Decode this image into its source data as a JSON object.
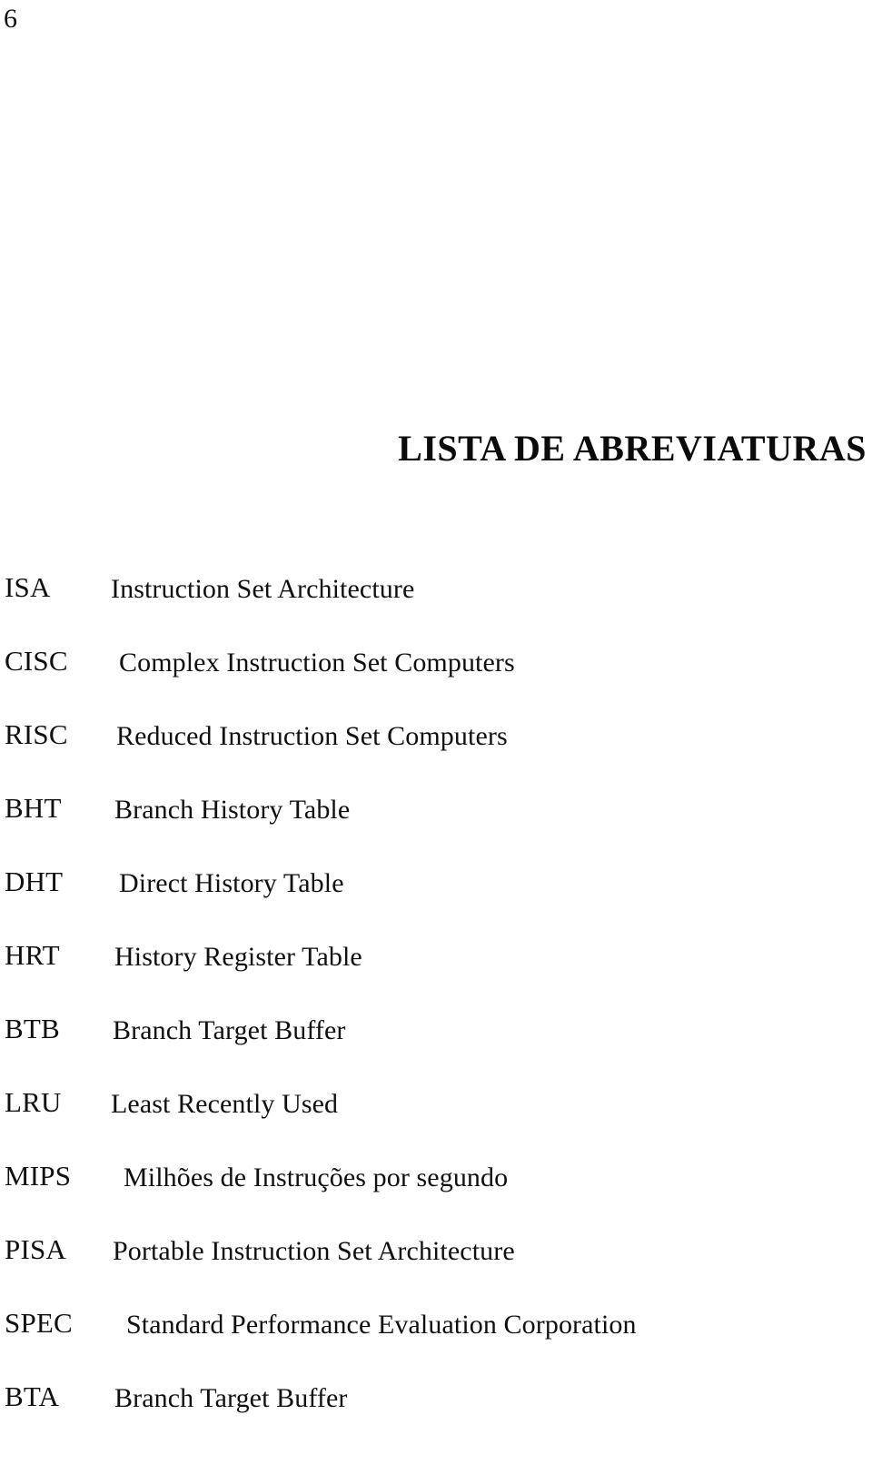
{
  "document": {
    "page_number": "6",
    "heading": "LISTA DE ABREVIATURAS"
  },
  "abbreviations": {
    "entries": [
      {
        "term": "ISA",
        "definition": "Instruction Set Architecture",
        "indent": 122
      },
      {
        "term": "CISC",
        "definition": "Complex Instruction Set Computers",
        "indent": 131
      },
      {
        "term": "RISC",
        "definition": "Reduced Instruction Set Computers",
        "indent": 128
      },
      {
        "term": "BHT",
        "definition": "Branch History Table",
        "indent": 126
      },
      {
        "term": "DHT",
        "definition": "Direct History Table",
        "indent": 131
      },
      {
        "term": "HRT",
        "definition": "History Register Table",
        "indent": 126
      },
      {
        "term": "BTB",
        "definition": "Branch Target Buffer",
        "indent": 124
      },
      {
        "term": "LRU",
        "definition": "Least Recently Used",
        "indent": 122
      },
      {
        "term": "MIPS",
        "definition": "Milhões de Instruções por segundo",
        "indent": 136
      },
      {
        "term": "PISA",
        "definition": "Portable Instruction Set Architecture",
        "indent": 124
      },
      {
        "term": "SPEC",
        "definition": "Standard Performance Evaluation Corporation",
        "indent": 139
      },
      {
        "term": "BTA",
        "definition": "Branch Target Buffer",
        "indent": 126
      }
    ]
  }
}
